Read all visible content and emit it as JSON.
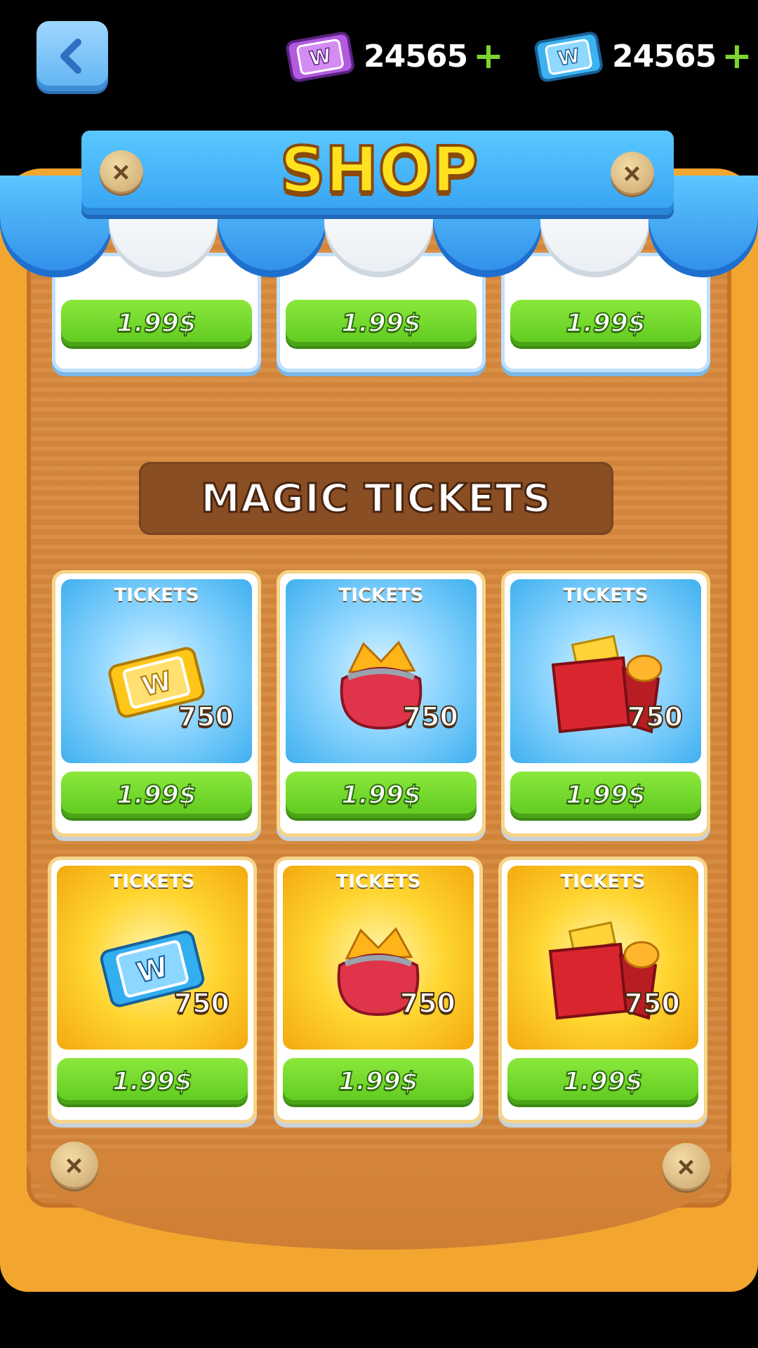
{
  "header": {
    "currencies": [
      {
        "icon": "purple-ticket-icon",
        "amount": "24565",
        "plus": "+"
      },
      {
        "icon": "blue-ticket-icon",
        "amount": "24565",
        "plus": "+"
      }
    ]
  },
  "shop": {
    "title": "SHOP",
    "top_row_prices": [
      "1.99$",
      "1.99$",
      "1.99$"
    ],
    "section_title": "MAGIC TICKETS",
    "items": [
      {
        "label": "TICKETS",
        "count": "750",
        "price": "1.99$",
        "icon": "gold-ticket-icon",
        "bg": "blue"
      },
      {
        "label": "TICKETS",
        "count": "750",
        "price": "1.99$",
        "icon": "red-purse-icon",
        "bg": "blue"
      },
      {
        "label": "TICKETS",
        "count": "750",
        "price": "1.99$",
        "icon": "gift-box-icon",
        "bg": "blue"
      },
      {
        "label": "TICKETS",
        "count": "750",
        "price": "1.99$",
        "icon": "blue-ticket-icon",
        "bg": "yellow"
      },
      {
        "label": "TICKETS",
        "count": "750",
        "price": "1.99$",
        "icon": "red-purse-icon",
        "bg": "yellow"
      },
      {
        "label": "TICKETS",
        "count": "750",
        "price": "1.99$",
        "icon": "gift-box-icon",
        "bg": "yellow"
      }
    ]
  },
  "colors": {
    "accent_green": "#7cd42e",
    "title_yellow": "#ffe11f",
    "awning_blue": "#2f8de8",
    "board_orange": "#f3a62f"
  }
}
